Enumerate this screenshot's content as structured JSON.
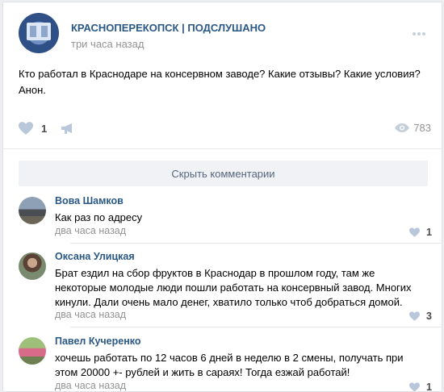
{
  "post": {
    "group_name": "КРАСНОПЕРЕКОПСК | ПОДСЛУШАНО",
    "time": "три часа назад",
    "text": "Кто работал в Краснодаре на консервном заводе? Какие отзывы? Какие условия? Анон.",
    "likes": "1",
    "views": "783",
    "avatar_icon": "group-logo",
    "more_icon": "more-dots-icon"
  },
  "comments_toggle": "Скрыть комментарии",
  "comments": [
    {
      "name": "Вова Шамков",
      "text": "Как раз по адресу",
      "time": "два часа назад",
      "likes": "1"
    },
    {
      "name": "Оксана Улицкая",
      "text": "Брат ездил на сбор фруктов в Краснодар в прошлом году, там же некоторые молодые люди пошли работать на консервный завод. Многих кинули. Дали очень мало денег, хватило только чтоб добраться домой.",
      "time": "два часа назад",
      "likes": "3"
    },
    {
      "name": "Павел Кучеренко",
      "text": "хочешь работать по 12 часов 6 дней в неделю в 2 смены, получать при этом 20000 +- рублей и жить в сараях! Тогда езжай работай!",
      "time": "два часа назад",
      "likes": "1"
    }
  ],
  "colors": {
    "link": "#2a5885",
    "muted": "#939393",
    "icon": "#b8c7d9",
    "toggle_bg": "#f0f2f5"
  }
}
